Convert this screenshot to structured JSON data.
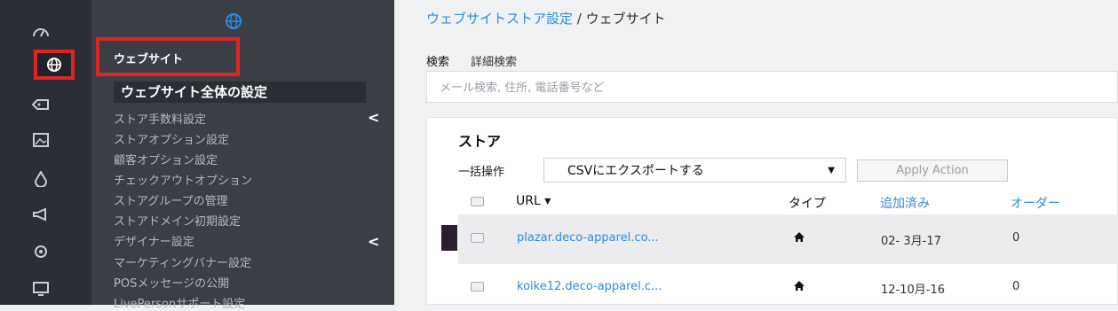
{
  "breadcrumb": {
    "parent": "ウェブサイトストア設定",
    "separator": "/",
    "current": "ウェブサイト"
  },
  "rail": {
    "icons": [
      "dashboard-icon",
      "globe-icon",
      "tag-icon",
      "image-icon",
      "drop-icon",
      "megaphone-icon",
      "settings-icon",
      "monitor-icon"
    ],
    "active": "globe-icon"
  },
  "sidebar": {
    "section_title": "ウェブサイト",
    "active_item": "ウェブサイト全体の設定",
    "items": [
      "ストア手数料設定",
      "ストアオプション設定",
      "顧客オプション設定",
      "チェックアウトオプション",
      "ストアグループの管理",
      "ストアドメイン初期設定",
      "デザイナー設定",
      "マーケティングバナー設定",
      "POSメッセージの公開",
      "LivePersonサポート設定"
    ],
    "chevron": "<"
  },
  "tabs": {
    "search": "検索",
    "advanced": "詳細検索"
  },
  "search": {
    "placeholder": "メール検索, 住所, 電話番号など",
    "value": ""
  },
  "store_card": {
    "title": "ストア",
    "bulk_label": "一括操作",
    "bulk_select": "CSVにエクスポートする",
    "apply_button": "Apply Action",
    "columns": {
      "url": "URL",
      "type": "タイプ",
      "added": "追加済み",
      "orders": "オーダー"
    },
    "rows": [
      {
        "url": "plazar.deco-apparel.co...",
        "type_icon": "home-icon",
        "added": "02- 3月-17",
        "orders": "0"
      },
      {
        "url": "koike12.deco-apparel.c...",
        "type_icon": "home-icon",
        "added": "12-10月-16",
        "orders": "0"
      }
    ]
  },
  "colors": {
    "accent": "#2e8be6",
    "highlight": "#e02424",
    "rail": "#2b2f35",
    "sidebar": "#3a3e45"
  }
}
